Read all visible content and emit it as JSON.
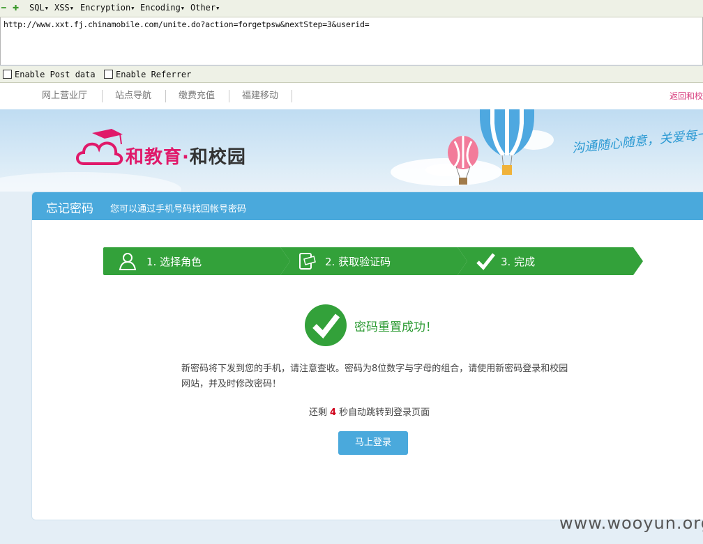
{
  "hackbar": {
    "menus": [
      "SQL",
      "XSS",
      "Encryption",
      "Encoding",
      "Other"
    ],
    "url": "http://www.xxt.fj.chinamobile.com/unite.do?action=forgetpsw&nextStep=3&userid=",
    "options": [
      "Enable Post data",
      "Enable Referrer"
    ]
  },
  "site": {
    "nav": [
      "网上营业厅",
      "站点导航",
      "缴费充值",
      "福建移动"
    ],
    "nav_right": "返回和校",
    "logo": {
      "brand": "和教育",
      "dot": "·",
      "name": "和校园"
    },
    "slogan": "沟通随心随意，关爱每一"
  },
  "page": {
    "title": "忘记密码",
    "subtitle": "您可以通过手机号码找回帐号密码",
    "steps": [
      "1. 选择角色",
      "2. 获取验证码",
      "3. 完成"
    ],
    "success_title": "密码重置成功！",
    "message": "新密码将下发到您的手机，请注意查收。密码为8位数字与字母的组合，请使用新密码登录和校园网站，并及时修改密码！",
    "countdown": {
      "before": "还剩",
      "seconds": "4",
      "after": "秒自动跳转到登录页面"
    },
    "login_button": "马上登录"
  },
  "watermark": "www.wooyun.org",
  "colors": {
    "accent_blue": "#4aa9dc",
    "step_green": "#33a13a",
    "brand_pink": "#e0196a"
  }
}
